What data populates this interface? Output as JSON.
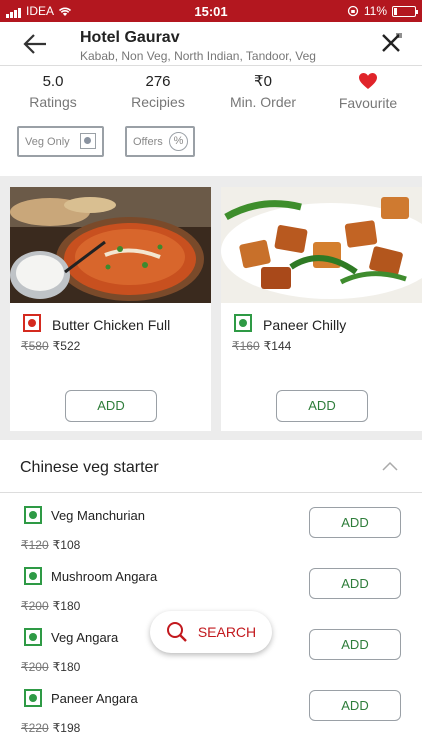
{
  "status": {
    "carrier": "IDEA",
    "time": "15:01",
    "battery": "11%"
  },
  "header": {
    "title": "Hotel Gaurav",
    "subtitle": "Kabab, Non Veg, North Indian, Tandoor, Veg"
  },
  "stats": [
    {
      "value": "5.0",
      "label": "Ratings"
    },
    {
      "value": "276",
      "label": "Recipies"
    },
    {
      "value": "₹0",
      "label": "Min. Order"
    },
    {
      "label": "Favourite"
    }
  ],
  "filters": {
    "veg_only": "Veg Only",
    "offers": "Offers",
    "offers_icon": "%"
  },
  "featured": [
    {
      "name": "Butter Chicken Full",
      "old_price": "₹580",
      "price": "₹522",
      "type": "non-veg",
      "add": "ADD"
    },
    {
      "name": "Paneer Chilly",
      "old_price": "₹160",
      "price": "₹144",
      "type": "veg",
      "add": "ADD"
    }
  ],
  "section": {
    "title": "Chinese veg starter"
  },
  "items": [
    {
      "name": "Veg Manchurian",
      "old_price": "₹120",
      "price": "₹108",
      "add": "ADD"
    },
    {
      "name": "Mushroom Angara",
      "old_price": "₹200",
      "price": "₹180",
      "add": "ADD"
    },
    {
      "name": "Veg Angara",
      "old_price": "₹200",
      "price": "₹180",
      "add": "ADD"
    },
    {
      "name": "Paneer Angara",
      "old_price": "₹220",
      "price": "₹198",
      "add": "ADD"
    }
  ],
  "search": {
    "label": "SEARCH"
  },
  "colors": {
    "brand": "#b3171f",
    "veg": "#2e9a45",
    "nonveg": "#d42a1f"
  }
}
